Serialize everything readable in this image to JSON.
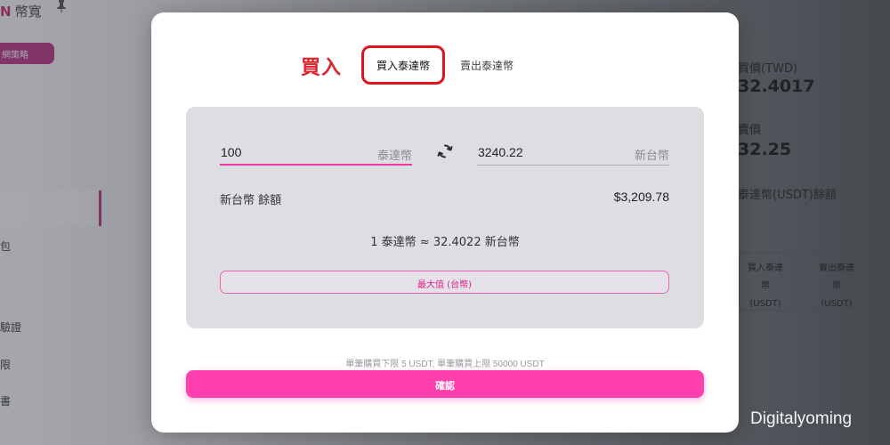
{
  "background": {
    "logo_mark": "N",
    "app_title": "幣寬",
    "pin_icon": "pin-icon",
    "strategy_button": "網策略",
    "sidebar": [
      "包",
      "驗證",
      "限",
      "書"
    ],
    "right_panel": {
      "label_1": "買價(TWD)",
      "value_1": "32.4017",
      "label_2": "賣價",
      "value_2": "32.25",
      "label_3": "泰達幣(USDT)餘額",
      "buy_box": [
        "買入泰達",
        "幣",
        "(USDT)"
      ],
      "sell_box": [
        "賣出泰達",
        "幣",
        "(USDT)"
      ]
    }
  },
  "watermark": "Digitalyoming",
  "modal": {
    "annotation_label": "買入",
    "tabs": [
      {
        "label": "買入泰達幣",
        "active": true
      },
      {
        "label": "賣出泰達幣",
        "active": false
      }
    ],
    "from_field": {
      "value": "100",
      "unit": "泰達幣"
    },
    "to_field": {
      "value": "3240.22",
      "unit": "新台幣"
    },
    "swap_icon": "swap-arrows-icon",
    "balance": {
      "label": "新台幣 餘額",
      "value": "$3,209.78"
    },
    "rate": "1 泰達幣 ≈ 32.4022 新台幣",
    "max_button": "最大值 (台幣)",
    "limit_note": "單筆購買下限 5 USDT, 單筆購買上限 50000 USDT",
    "confirm_button": "確認"
  },
  "colors": {
    "accent": "#ff3fae",
    "annotation_red": "#e0141c",
    "panel_bg": "#dcdee2"
  }
}
